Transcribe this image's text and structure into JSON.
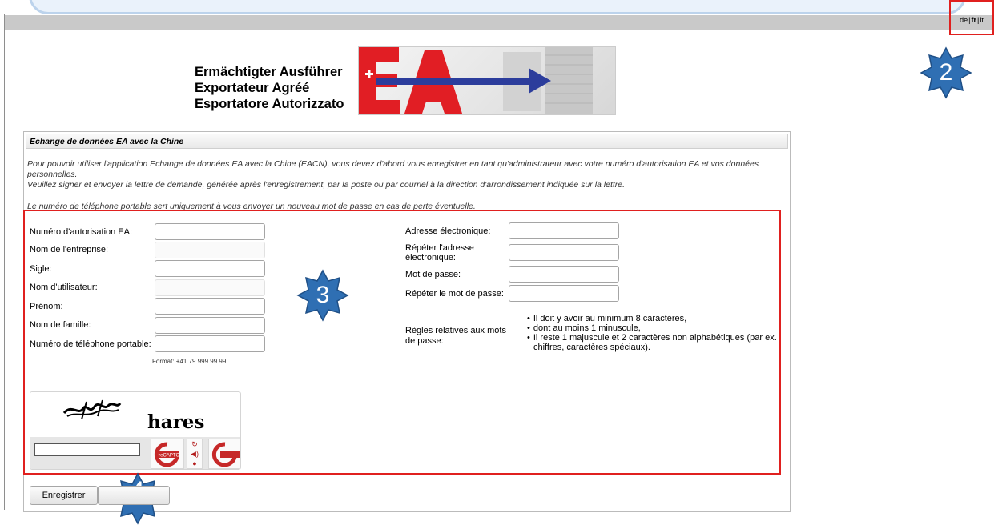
{
  "language_switch": {
    "de": "de",
    "fr": "fr",
    "it": "it",
    "separator": "|"
  },
  "logo": {
    "line1": "Ermächtigter Ausführer",
    "line2": "Exportateur Agréé",
    "line3": "Esportatore Autorizzato",
    "mark": "EA"
  },
  "panel": {
    "title": "Echange de données EA avec la Chine",
    "intro1": "Pour pouvoir utiliser l'application Echange de données EA avec la Chine (EACN), vous devez d'abord vous enregistrer en tant qu'administrateur avec votre numéro d'autorisation EA et vos données personnelles.",
    "intro2": "Veuillez signer et envoyer la lettre de demande, générée après l'enregistrement, par la poste ou par courriel à la direction d'arrondissement indiquée sur la lettre.",
    "intro3": "Le numéro de téléphone portable sert uniquement à vous envoyer un nouveau mot de passe en cas de perte éventuelle."
  },
  "form": {
    "left": [
      {
        "label": "Numéro d'autorisation EA:",
        "value": "",
        "disabled": false
      },
      {
        "label": "Nom de l'entreprise:",
        "value": "",
        "disabled": true
      },
      {
        "label": "Sigle:",
        "value": "",
        "disabled": false
      },
      {
        "label": "Nom d'utilisateur:",
        "value": "",
        "disabled": true
      },
      {
        "label": "Prénom:",
        "value": "",
        "disabled": false
      },
      {
        "label": "Nom de famille:",
        "value": "",
        "disabled": false
      },
      {
        "label": "Numéro de téléphone portable:",
        "value": "",
        "disabled": false
      }
    ],
    "phone_format": "Format: +41 79 999 99 99",
    "right": [
      {
        "label": "Adresse électronique:",
        "value": ""
      },
      {
        "label_line1": "Répéter l'adresse",
        "label_line2": "électronique:",
        "value": ""
      },
      {
        "label": "Mot de passe:",
        "value": ""
      },
      {
        "label": "Répéter le mot de passe:",
        "value": ""
      }
    ],
    "rules_label_line1": "Règles relatives aux mots",
    "rules_label_line2": "de passe:",
    "rules": [
      "Il doit y avoir au minimum 8 caractères,",
      "dont au moins 1 minuscule,",
      "Il reste 1 majuscule et 2 caractères non alphabétiques (par ex. chiffres, caractères spéciaux)."
    ]
  },
  "captcha": {
    "word": "hares",
    "brand": "reCAPTCHA",
    "input_value": ""
  },
  "buttons": {
    "register": "Enregistrer"
  },
  "annotations": {
    "lang_marker": "2",
    "form_marker": "3",
    "button_marker": "4"
  },
  "colors": {
    "highlight_red": "#e0201f",
    "marker_blue": "#2f6fb3",
    "flag_red": "#e11e24",
    "arrow_blue": "#2c3d9c"
  }
}
